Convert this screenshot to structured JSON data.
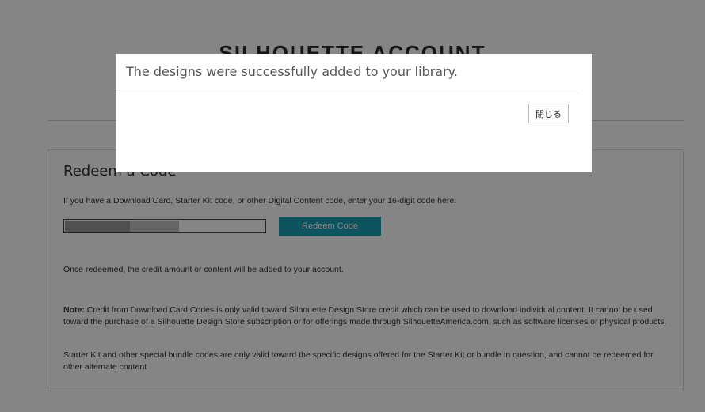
{
  "page": {
    "title": "SILHOUETTE ACCOUNT"
  },
  "redeem_panel": {
    "heading": "Redeem a Code",
    "instruction": "If you have a Download Card, Starter Kit code, or other Digital Content code, enter your 16-digit code here:",
    "code_input": {
      "value": "",
      "placeholder": ""
    },
    "redeem_button_label": "Redeem Code",
    "redeemed_info": "Once redeemed, the credit amount or content will be added to your account.",
    "note_label": "Note:",
    "note_text": " Credit from Download Card Codes is only valid toward Silhouette Design Store credit which can be used to download individual content. It cannot be used toward the purchase of a Silhouette Design Store subscription or for offerings made through SilhouetteAmerica.com, such as software licenses or physical products.",
    "starter_kit_text": "Starter Kit and other special bundle codes are only valid toward the specific designs offered for the Starter Kit or bundle in question, and cannot be redeemed for other alternate content"
  },
  "modal": {
    "message": "The designs were successfully added to your library.",
    "close_label": "閉じる"
  },
  "colors": {
    "accent": "#1aa1b5",
    "overlay": "rgba(0,0,0,0.48)"
  }
}
